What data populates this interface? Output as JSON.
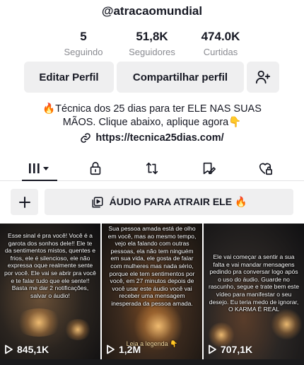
{
  "profile": {
    "username": "@atracaomundial",
    "stats": [
      {
        "value": "5",
        "label": "Seguindo"
      },
      {
        "value": "51,8K",
        "label": "Seguidores"
      },
      {
        "value": "474.0K",
        "label": "Curtidas"
      }
    ],
    "edit_label": "Editar Perfil",
    "share_label": "Compartilhar perfil",
    "bio_line1": "🔥Técnica dos 25 dias para ter ELE NAS SUAS",
    "bio_line2": "MÃOS. Clique abaixo, aplique agora👇",
    "link": "https://tecnica25dias.com/"
  },
  "tabs": [
    {
      "icon": "videos-grid-icon",
      "active": true
    },
    {
      "icon": "lock-icon",
      "active": false
    },
    {
      "icon": "repost-icon",
      "active": false
    },
    {
      "icon": "saved-icon",
      "active": false
    },
    {
      "icon": "liked-icon",
      "active": false
    }
  ],
  "audio_button_label": "ÁUDIO PARA ATRAIR ELE 🔥",
  "videos": [
    {
      "text": "Esse sinal é pra você! Você é a garota dos sonhos dele!! Ele te da sentimentos mistos, quentes e frios, ele é silencioso, ele não expressa oque realmente sente por você. Ele vai se abrir pra você e te falar tudo que ele sente!! Basta me dar 2 notificações, salvar o áudio!",
      "caption": "",
      "views": "845,1K"
    },
    {
      "text": "Sua pessoa amada está de olho em você, mas ao mesmo tempo, vejo ela falando com outras pessoas, ela não tem ninguém em sua vida, ele gosta de falar com mulheres mas nada sério, porque ele tem sentimentos por você, em 27 minutos depois de você usar este áudio você vai receber uma mensagem inesperada da pessoa amada.",
      "caption": "Leia a legenda 👇",
      "views": "1,2M"
    },
    {
      "text": "Ele vai começar a sentir a sua falta e vai mandar mensagens pedindo pra conversar logo após o uso do áudio. Guarde no rascunho, segue e trate bem este vídeo para manifestar o seu desejo. Eu teria medo de ignorar, O KARMA É REAL",
      "caption": "",
      "views": "707,1K"
    }
  ]
}
